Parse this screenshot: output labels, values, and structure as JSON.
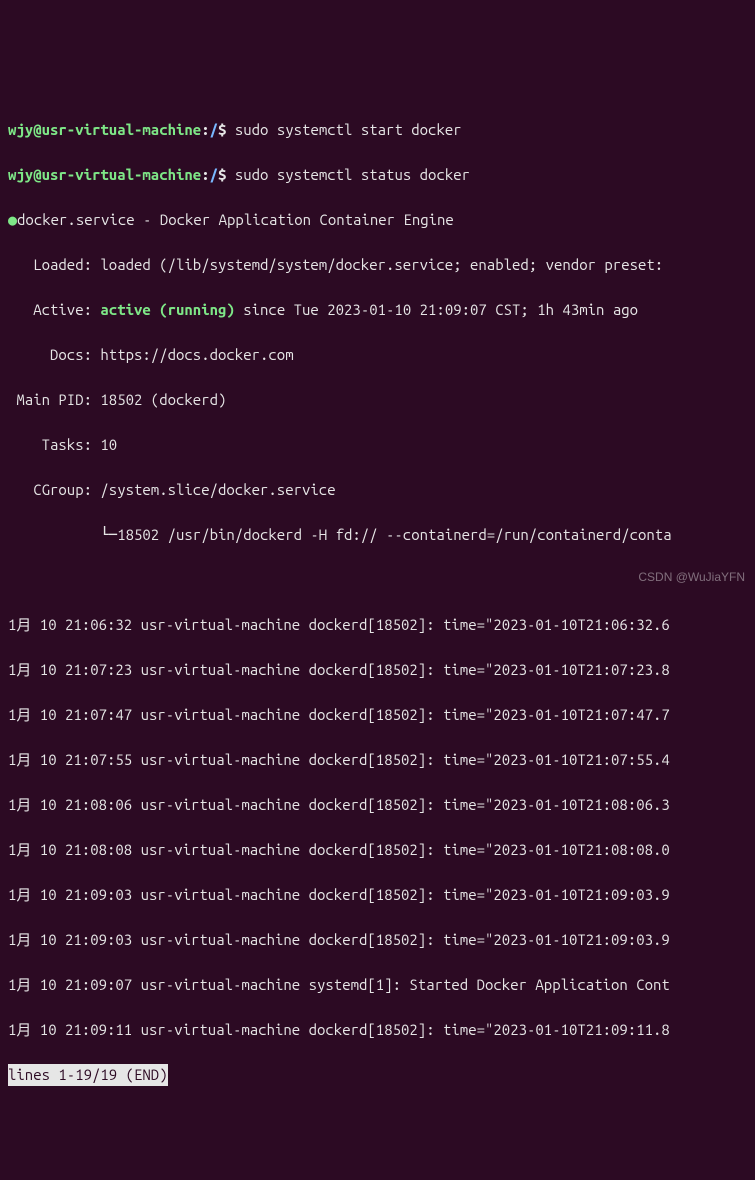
{
  "prompt": {
    "user": "wjy",
    "host": "usr-virtual-machine",
    "path": "/",
    "sep": "$"
  },
  "commands": {
    "start": "sudo systemctl start docker",
    "status": "sudo systemctl status docker"
  },
  "service": {
    "dot": "●",
    "name": "docker.service - Docker Application Container Engine",
    "loaded_label": "   Loaded: ",
    "loaded_value": "loaded (/lib/systemd/system/docker.service; enabled; vendor preset:",
    "active_label": "   Active: ",
    "active_value": "active (running)",
    "active_since": " since Tue 2023-01-10 21:09:07 CST; 1h 43min ago",
    "docs_label": "     Docs: ",
    "docs_value": "https://docs.docker.com",
    "mainpid_label": " Main PID: ",
    "mainpid_value": "18502 (dockerd)",
    "tasks_label": "    Tasks: ",
    "tasks_value": "10",
    "cgroup_label": "   CGroup: ",
    "cgroup_value": "/system.slice/docker.service",
    "cgroup_tree": "           └─18502 /usr/bin/dockerd -H fd:// --containerd=/run/containerd/conta"
  },
  "logs": [
    "1月 10 21:06:32 usr-virtual-machine dockerd[18502]: time=\"2023-01-10T21:06:32.6",
    "1月 10 21:07:23 usr-virtual-machine dockerd[18502]: time=\"2023-01-10T21:07:23.8",
    "1月 10 21:07:47 usr-virtual-machine dockerd[18502]: time=\"2023-01-10T21:07:47.7",
    "1月 10 21:07:55 usr-virtual-machine dockerd[18502]: time=\"2023-01-10T21:07:55.4",
    "1月 10 21:08:06 usr-virtual-machine dockerd[18502]: time=\"2023-01-10T21:08:06.3",
    "1月 10 21:08:08 usr-virtual-machine dockerd[18502]: time=\"2023-01-10T21:08:08.0",
    "1月 10 21:09:03 usr-virtual-machine dockerd[18502]: time=\"2023-01-10T21:09:03.9",
    "1月 10 21:09:03 usr-virtual-machine dockerd[18502]: time=\"2023-01-10T21:09:03.9",
    "1月 10 21:09:07 usr-virtual-machine systemd[1]: Started Docker Application Cont",
    "1月 10 21:09:11 usr-virtual-machine dockerd[18502]: time=\"2023-01-10T21:09:11.8"
  ],
  "pager": "lines 1-19/19 (END)",
  "watermark": "CSDN @WuJiaYFN"
}
